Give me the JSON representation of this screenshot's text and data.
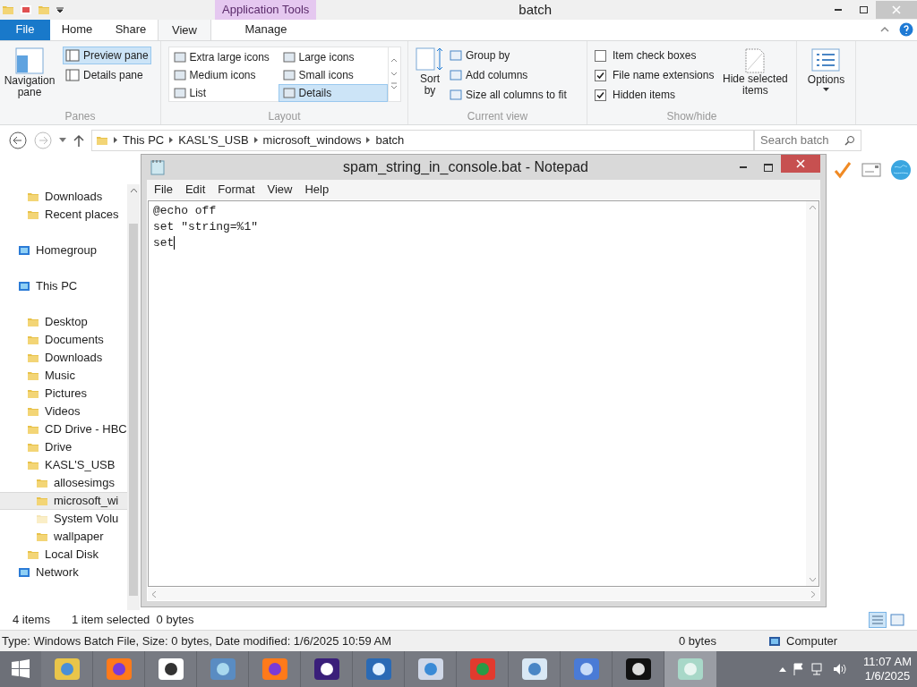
{
  "window": {
    "title": "batch",
    "contextual_header": "Application Tools"
  },
  "ribbon_tabs": [
    {
      "label": "File",
      "kind": "file",
      "selected": false
    },
    {
      "label": "Home",
      "kind": "tab",
      "selected": false
    },
    {
      "label": "Share",
      "kind": "tab",
      "selected": false
    },
    {
      "label": "View",
      "kind": "tab",
      "selected": true
    },
    {
      "label": "Manage",
      "kind": "contextual",
      "selected": false
    }
  ],
  "ribbon": {
    "panes": {
      "label": "Panes",
      "navigation_pane": "Navigation pane",
      "items": [
        {
          "label": "Preview pane",
          "selected": true
        },
        {
          "label": "Details pane",
          "selected": false
        }
      ]
    },
    "layout": {
      "label": "Layout",
      "items": [
        {
          "label": "Extra large icons",
          "selected": false
        },
        {
          "label": "Large icons",
          "selected": false
        },
        {
          "label": "Medium icons",
          "selected": false
        },
        {
          "label": "Small icons",
          "selected": false
        },
        {
          "label": "List",
          "selected": false
        },
        {
          "label": "Details",
          "selected": true
        }
      ]
    },
    "current_view": {
      "label": "Current view",
      "sort_by": "Sort by",
      "items": [
        "Group by",
        "Add columns",
        "Size all columns to fit"
      ]
    },
    "show_hide": {
      "label": "Show/hide",
      "checkboxes": [
        {
          "label": "Item check boxes",
          "checked": false
        },
        {
          "label": "File name extensions",
          "checked": true
        },
        {
          "label": "Hidden items",
          "checked": true
        }
      ],
      "hide_selected": "Hide selected items"
    },
    "options": "Options"
  },
  "breadcrumb": [
    "This PC",
    "KASL'S_USB",
    "microsoft_windows",
    "batch"
  ],
  "search": {
    "placeholder": "Search batch"
  },
  "nav": {
    "top_children": [
      {
        "label": "Downloads"
      },
      {
        "label": "Recent places"
      }
    ],
    "items": [
      {
        "label": "Homegroup",
        "selected": false
      },
      {
        "label": "This PC",
        "selected": false,
        "children": [
          {
            "label": "Desktop",
            "selected": false
          },
          {
            "label": "Documents",
            "selected": false
          },
          {
            "label": "Downloads",
            "selected": false
          },
          {
            "label": "Music",
            "selected": false
          },
          {
            "label": "Pictures",
            "selected": false
          },
          {
            "label": "Videos",
            "selected": false
          },
          {
            "label": "CD Drive - HBC",
            "selected": false
          },
          {
            "label": "Drive",
            "selected": false
          },
          {
            "label": "KASL'S_USB",
            "selected": false,
            "children": [
              {
                "label": "allosesimgs",
                "selected": false,
                "hidden": false
              },
              {
                "label": "microsoft_wi",
                "selected": true,
                "hidden": false
              },
              {
                "label": "System Volu",
                "selected": false,
                "hidden": true
              },
              {
                "label": "wallpaper",
                "selected": false,
                "hidden": false
              }
            ]
          },
          {
            "label": "Local Disk",
            "selected": false
          }
        ]
      },
      {
        "label": "Network",
        "selected": false
      }
    ]
  },
  "status_bar": {
    "items_count": "4 items",
    "selection": "1 item selected  0 bytes"
  },
  "details_bar": {
    "info": "Type: Windows Batch File, Size: 0 bytes, Date modified: 1/6/2025 10:59 AM",
    "size": "0 bytes",
    "location": "Computer"
  },
  "notepad": {
    "title": "spam_string_in_console.bat - Notepad",
    "menu": [
      "File",
      "Edit",
      "Format",
      "View",
      "Help"
    ],
    "lines": [
      "@echo off",
      "set \"string=%1\"",
      "set"
    ]
  },
  "taskbar": {
    "buttons": [
      {
        "selected": false
      },
      {
        "selected": false
      },
      {
        "selected": false
      },
      {
        "selected": false
      },
      {
        "selected": false
      },
      {
        "selected": false
      },
      {
        "selected": false
      },
      {
        "selected": false
      },
      {
        "selected": false
      },
      {
        "selected": false
      },
      {
        "selected": false
      },
      {
        "selected": false
      },
      {
        "selected": true
      }
    ],
    "time": "11:07 AM",
    "date": "1/6/2025"
  }
}
